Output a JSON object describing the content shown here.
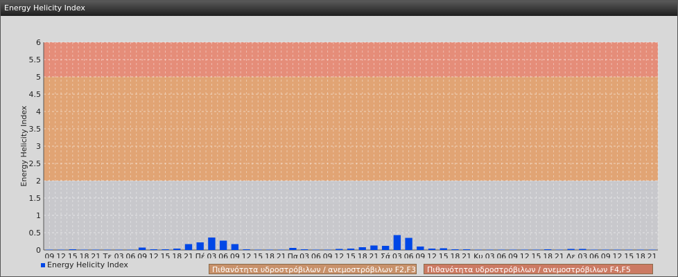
{
  "window": {
    "title": "Energy Helicity Index"
  },
  "legend": {
    "label": "Energy Helicity Index"
  },
  "bands": [
    {
      "label": "Πιθανότητα υδροστρόβιλων / ανεμοστρόβιλων F2,F3",
      "from": 2,
      "to": 5,
      "color": "#e3a06a"
    },
    {
      "label": "Πιθανότητα υδροστρόβιλων / ανεμοστρόβιλων F4,F5",
      "from": 5,
      "to": 6,
      "color": "#e88670"
    }
  ],
  "chart_data": {
    "type": "bar",
    "ylabel": "Energy Helicity Index",
    "ylim": [
      0,
      6
    ],
    "yticks": [
      0,
      0.5,
      1,
      1.5,
      2,
      2.5,
      3,
      3.5,
      4,
      4.5,
      5,
      5.5,
      6
    ],
    "grid": true,
    "legend_position": "bottom-left",
    "bar_color": "#0047e6",
    "categories": [
      "09",
      "12",
      "15",
      "18",
      "21",
      "Τε",
      "03",
      "06",
      "09",
      "12",
      "15",
      "18",
      "21",
      "Πέ",
      "03",
      "06",
      "09",
      "12",
      "15",
      "18",
      "21",
      "Πα",
      "03",
      "06",
      "09",
      "12",
      "15",
      "18",
      "21",
      "Σά",
      "03",
      "06",
      "09",
      "12",
      "15",
      "18",
      "21",
      "Κυ",
      "03",
      "06",
      "09",
      "12",
      "15",
      "18",
      "21",
      "Δε",
      "03",
      "06",
      "09",
      "12",
      "15",
      "18",
      "21"
    ],
    "values": [
      0.01,
      0.01,
      0.02,
      0.01,
      0.01,
      0.01,
      0.01,
      0.01,
      0.07,
      0.02,
      0.02,
      0.04,
      0.17,
      0.22,
      0.36,
      0.27,
      0.17,
      0.02,
      0.01,
      0.01,
      0.01,
      0.06,
      0.02,
      0.01,
      0.01,
      0.03,
      0.04,
      0.08,
      0.13,
      0.12,
      0.43,
      0.35,
      0.1,
      0.04,
      0.05,
      0.02,
      0.02,
      0.01,
      0.01,
      0.01,
      0.01,
      0.01,
      0.01,
      0.02,
      0.01,
      0.03,
      0.03,
      0.01,
      0.01,
      0.01,
      0.01,
      0.01,
      0.01
    ],
    "series": [
      {
        "name": "Energy Helicity Index"
      }
    ]
  }
}
